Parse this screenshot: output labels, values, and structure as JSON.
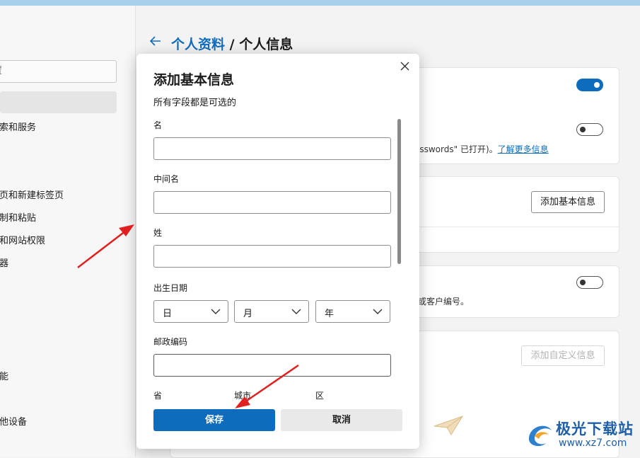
{
  "sidebar": {
    "search_partial": "置",
    "items": [
      {
        "label": "索和服务"
      },
      {
        "label": "页和新建标签页"
      },
      {
        "label": "制和粘贴"
      },
      {
        "label": "和网站权限"
      },
      {
        "label": "器"
      },
      {
        "label": "能"
      },
      {
        "label": "他设备"
      }
    ]
  },
  "header": {
    "breadcrumb_parent": "个人资料",
    "breadcrumb_sep": " / ",
    "breadcrumb_current": "个人信息"
  },
  "background": {
    "card1_text": "asswords\" 已打开)。",
    "card1_link": "了解更多信息",
    "card2_button": "添加基本信息",
    "card3_text": "或客户编号。",
    "card4_button": "添加自定义信息"
  },
  "dialog": {
    "title": "添加基本信息",
    "subtitle": "所有字段都是可选的",
    "fields": {
      "first_name_label": "名",
      "first_name_value": "",
      "middle_name_label": "中间名",
      "middle_name_value": "",
      "last_name_label": "姓",
      "last_name_value": "",
      "birthdate_label": "出生日期",
      "day_value": "日",
      "month_value": "月",
      "year_value": "年",
      "postal_label": "邮政编码",
      "postal_value": "",
      "province_label": "省",
      "city_label": "城市",
      "district_label": "区"
    },
    "save_label": "保存",
    "cancel_label": "取消"
  },
  "watermark": {
    "text": "极光下载站",
    "url": "www.xz7.com"
  },
  "colors": {
    "accent": "#0f6cbd",
    "annotation_arrow": "#e02020"
  }
}
